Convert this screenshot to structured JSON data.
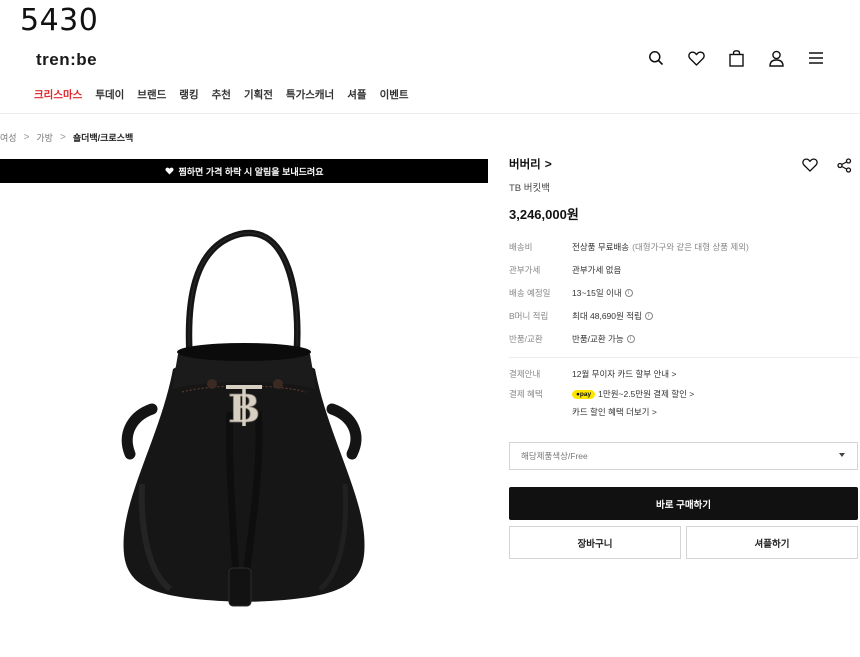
{
  "overlay_id": "5430",
  "site": {
    "logo": "tren:be"
  },
  "header": {
    "icons": [
      "search-icon",
      "heart-icon",
      "shopping-bag-icon",
      "user-icon",
      "menu-icon"
    ]
  },
  "nav": {
    "items": [
      {
        "label": "크리스마스",
        "active": true
      },
      {
        "label": "투데이",
        "active": false
      },
      {
        "label": "브랜드",
        "active": false
      },
      {
        "label": "랭킹",
        "active": false
      },
      {
        "label": "추천",
        "active": false
      },
      {
        "label": "기획전",
        "active": false
      },
      {
        "label": "특가스캐너",
        "active": false
      },
      {
        "label": "셔플",
        "active": false
      },
      {
        "label": "이벤트",
        "active": false
      }
    ],
    "active_color": "#e0282e"
  },
  "breadcrumb": {
    "items": [
      "여성",
      "가방",
      "숄더백/크로스백"
    ],
    "separator": ">"
  },
  "banner": {
    "text": "찜하면 가격 하락 시 알림을 보내드려요",
    "icon": "heart-filled-icon"
  },
  "product": {
    "brand": "버버리",
    "brand_chevron": ">",
    "name": "TB 버킷백",
    "price": "3,246,000원"
  },
  "actions": {
    "icons": [
      "heart-icon",
      "share-icon"
    ]
  },
  "specs": [
    {
      "label": "배송비",
      "value": "전상품 무료배송",
      "note": "(대형가구와 같은 대형 상품 제외)"
    },
    {
      "label": "관부가세",
      "value": "관부가세 없음"
    },
    {
      "label": "배송 예정일",
      "value": "13~15일 이내"
    },
    {
      "label": "B머니 적립",
      "value": "최대 48,690원 적립"
    },
    {
      "label": "반품/교환",
      "value": "반품/교환 가능"
    }
  ],
  "payment": {
    "label_installment": "결제안내",
    "installment": "12월 무이자 카드 할부 안내 >",
    "label_benefit": "결제 혜택",
    "pay_badge": "●pay",
    "benefit": "1만원~2.5만원 결제 할인 >",
    "card_discount": "카드 할인 혜택 더보기 >"
  },
  "option_select": {
    "placeholder": "해당제품색상/Free"
  },
  "buttons": {
    "buy": "바로 구매하기",
    "cart": "장바구니",
    "gift": "셔플하기"
  },
  "colors": {
    "black": "#111111",
    "accent": "#e0282e",
    "pay_yellow": "#fee500"
  }
}
